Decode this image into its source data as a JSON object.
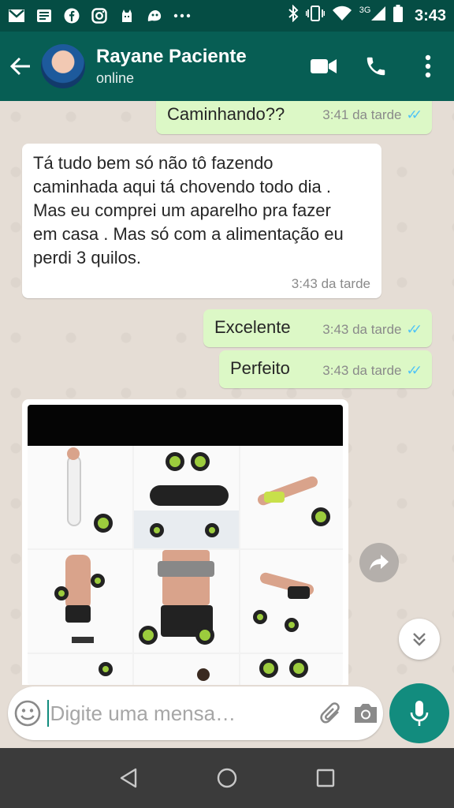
{
  "status_bar": {
    "time": "3:43",
    "network": "3G",
    "icons": [
      "gmail-icon",
      "news-icon",
      "facebook-icon",
      "instagram-icon",
      "cat-icon",
      "bot-icon",
      "more-dots-icon",
      "bluetooth-icon",
      "vibrate-icon",
      "wifi-icon",
      "signal-icon",
      "battery-icon"
    ]
  },
  "header": {
    "contact_name": "Rayane Paciente",
    "contact_status": "online"
  },
  "messages": [
    {
      "direction": "out",
      "text": "Caminhando??",
      "time": "3:41 da tarde",
      "read": true
    },
    {
      "direction": "in",
      "text": "Tá tudo bem só não tô fazendo caminhada aqui tá chovendo todo dia . Mas eu comprei um aparelho pra fazer em casa . Mas só com a alimentação eu perdi 3 quilos.",
      "time": "3:43 da tarde"
    },
    {
      "direction": "out",
      "text": "Excelente",
      "time": "3:43 da tarde",
      "read": true
    },
    {
      "direction": "out",
      "text": "Perfeito",
      "time": "3:43 da tarde",
      "read": true
    },
    {
      "direction": "in",
      "type": "image"
    }
  ],
  "composer": {
    "placeholder": "Digite uma mensa…"
  },
  "colors": {
    "header": "#075e54",
    "status_bar": "#054d44",
    "outgoing_bubble": "#dcf8c6",
    "incoming_bubble": "#ffffff",
    "read_ticks": "#4fc3f7",
    "mic_button": "#128c7e"
  }
}
